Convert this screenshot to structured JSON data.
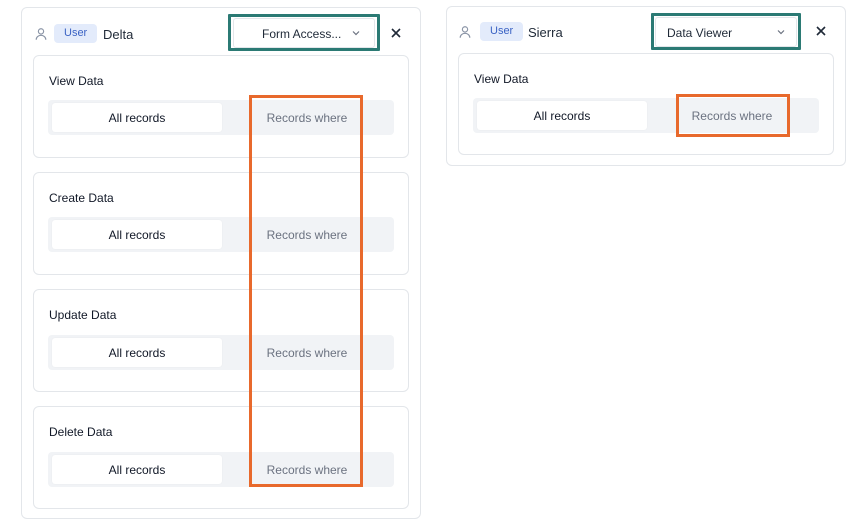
{
  "colors": {
    "teal_highlight": "#2b7a74",
    "orange_highlight": "#e8692c",
    "badge_bg": "#e3ebfb",
    "badge_text": "#3b63c4"
  },
  "panels": [
    {
      "badge": "User",
      "name": "Delta",
      "role": "Form Access...",
      "icons": {
        "user": "user-icon",
        "role_dropdown": "chevron-down-icon",
        "close": "close-icon"
      },
      "permissions": [
        {
          "title": "View Data",
          "options": [
            "All records",
            "Records where"
          ],
          "selected": "All records"
        },
        {
          "title": "Create Data",
          "options": [
            "All records",
            "Records where"
          ],
          "selected": "All records"
        },
        {
          "title": "Update Data",
          "options": [
            "All records",
            "Records where"
          ],
          "selected": "All records"
        },
        {
          "title": "Delete Data",
          "options": [
            "All records",
            "Records where"
          ],
          "selected": "All records"
        }
      ]
    },
    {
      "badge": "User",
      "name": "Sierra",
      "role": "Data Viewer",
      "icons": {
        "user": "user-icon",
        "role_dropdown": "chevron-down-icon",
        "close": "close-icon"
      },
      "permissions": [
        {
          "title": "View Data",
          "options": [
            "All records",
            "Records where"
          ],
          "selected": "All records"
        }
      ]
    }
  ]
}
